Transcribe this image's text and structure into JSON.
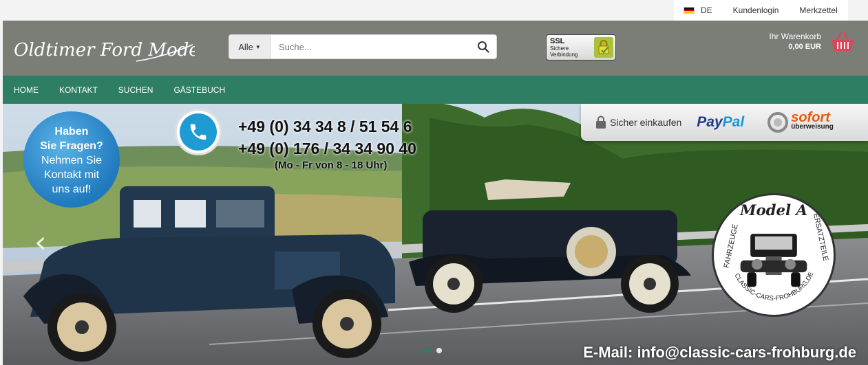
{
  "topbar": {
    "language": "DE",
    "login": "Kundenlogin",
    "wishlist": "Merkzettel"
  },
  "header": {
    "logo_text": "Oldtimer Ford Model A",
    "search": {
      "category": "Alle",
      "placeholder": "Suche..."
    },
    "ssl": {
      "label": "SSL",
      "line1": "Sichere",
      "line2": "Verbindung"
    },
    "cart": {
      "label": "Ihr Warenkorb",
      "total": "0,00 EUR"
    }
  },
  "nav": {
    "items": [
      "HOME",
      "KONTAKT",
      "SUCHEN",
      "GÄSTEBUCH"
    ]
  },
  "hero": {
    "bubble": {
      "line1": "Haben",
      "line2": "Sie Fragen?",
      "line3": "Nehmen Sie",
      "line4": "Kontakt mit",
      "line5": "uns auf!"
    },
    "phone1": "+49 (0) 34 34 8 / 51 54 6",
    "phone2": "+49 (0) 176 / 34 34 90 40",
    "hours": "(Mo - Fr von 8 - 18 Uhr)",
    "payment": {
      "secure": "Sicher einkaufen",
      "paypal_a": "Pay",
      "paypal_b": "Pal",
      "sofort": "sofort",
      "sofort_sub": "überweisung"
    },
    "seal": {
      "top": "Model A",
      "left": "FAHRZEUGE",
      "right": "ERSATZTEILE",
      "bottom": "CLASSIC-CARS-FROHBURG.DE"
    },
    "email": "E-Mail: info@classic-cars-frohburg.de",
    "prev": "‹",
    "next": "›"
  },
  "colors": {
    "header_bg": "#7b7d77",
    "nav_bg": "#2e7e63",
    "cart_icon": "#d9475b",
    "dot_active": "#2e7e63"
  }
}
